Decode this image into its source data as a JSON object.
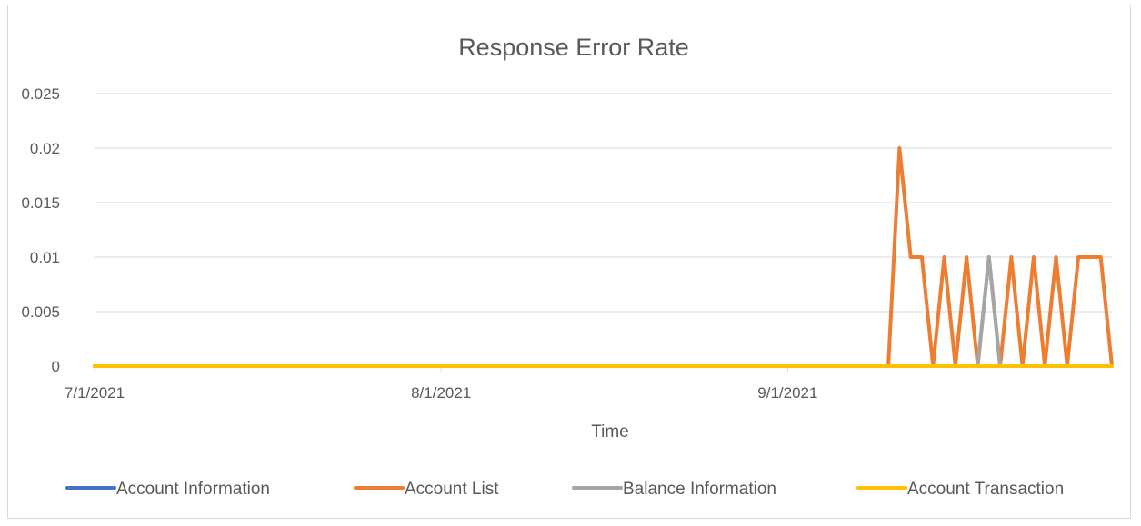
{
  "chart_data": {
    "type": "line",
    "title": "Response Error Rate",
    "xlabel": "Time",
    "ylabel": "",
    "ylim": [
      0,
      0.025
    ],
    "y_ticks": [
      "0",
      "0.005",
      "0.01",
      "0.015",
      "0.02",
      "0.025"
    ],
    "y_tick_values": [
      0,
      0.005,
      0.01,
      0.015,
      0.02,
      0.025
    ],
    "x_ticks": [
      "7/1/2021",
      "8/1/2021",
      "9/1/2021"
    ],
    "x_tick_values": [
      "2021-07-01",
      "2021-08-01",
      "2021-09-01"
    ],
    "xlim": [
      "2021-07-01",
      "2021-09-30"
    ],
    "grid": "horizontal",
    "legend_position": "bottom",
    "series": [
      {
        "name": "Account Information",
        "color": "#4472c4",
        "points": [
          [
            "2021-07-01",
            0
          ],
          [
            "2021-09-30",
            0
          ]
        ]
      },
      {
        "name": "Account List",
        "color": "#ed7d31",
        "points": [
          [
            "2021-07-01",
            0
          ],
          [
            "2021-09-10",
            0
          ],
          [
            "2021-09-11",
            0.02
          ],
          [
            "2021-09-12",
            0.01
          ],
          [
            "2021-09-13",
            0.01
          ],
          [
            "2021-09-14",
            0
          ],
          [
            "2021-09-15",
            0.01
          ],
          [
            "2021-09-16",
            0
          ],
          [
            "2021-09-17",
            0.01
          ],
          [
            "2021-09-18",
            0
          ],
          [
            "2021-09-19",
            0.01
          ],
          [
            "2021-09-20",
            0
          ],
          [
            "2021-09-21",
            0.01
          ],
          [
            "2021-09-22",
            0
          ],
          [
            "2021-09-23",
            0.01
          ],
          [
            "2021-09-24",
            0
          ],
          [
            "2021-09-25",
            0.01
          ],
          [
            "2021-09-26",
            0
          ],
          [
            "2021-09-27",
            0.01
          ],
          [
            "2021-09-28",
            0.01
          ],
          [
            "2021-09-29",
            0.01
          ],
          [
            "2021-09-30",
            0
          ]
        ]
      },
      {
        "name": "Balance Information",
        "color": "#a5a5a5",
        "points": [
          [
            "2021-07-01",
            0
          ],
          [
            "2021-09-18",
            0
          ],
          [
            "2021-09-19",
            0.01
          ],
          [
            "2021-09-20",
            0
          ],
          [
            "2021-09-30",
            0
          ]
        ]
      },
      {
        "name": "Account Transaction",
        "color": "#ffc000",
        "points": [
          [
            "2021-07-01",
            0
          ],
          [
            "2021-09-30",
            0
          ]
        ]
      }
    ]
  }
}
